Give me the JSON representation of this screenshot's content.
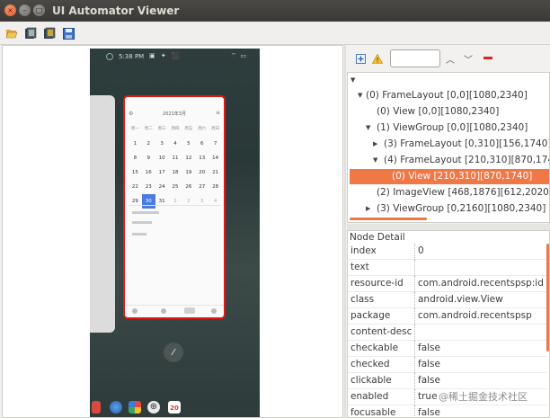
{
  "window": {
    "title": "UI Automator Viewer"
  },
  "icons": {
    "open": "folder-open-icon",
    "screenshot": "device-screenshot-icon",
    "screenshot_compressed": "device-screenshot-compressed-icon",
    "save": "save-icon",
    "expand": "expand-all-icon",
    "warning": "warning-icon",
    "prev": "chevron-up-icon",
    "next": "chevron-down-icon",
    "clear": "clear-icon"
  },
  "device": {
    "status_time": "5:38 PM",
    "calendar_month": "2021年3月",
    "weekdays": [
      "周一",
      "周二",
      "周三",
      "周四",
      "周五",
      "周六",
      "周日"
    ],
    "weeks": [
      [
        "1",
        "2",
        "3",
        "4",
        "5",
        "6",
        "7"
      ],
      [
        "8",
        "9",
        "10",
        "11",
        "12",
        "13",
        "14"
      ],
      [
        "15",
        "16",
        "17",
        "18",
        "19",
        "20",
        "21"
      ],
      [
        "22",
        "23",
        "24",
        "25",
        "26",
        "27",
        "28"
      ],
      [
        "29",
        "30",
        "31",
        "1",
        "2",
        "3",
        "4"
      ]
    ],
    "selected_day": "30",
    "dock_badge": "20"
  },
  "tree": {
    "nodes": [
      {
        "label": "(0) FrameLayout [0,0][1080,2340]",
        "arrow": "▼"
      },
      {
        "label": "(0) View [0,0][1080,2340]",
        "arrow": ""
      },
      {
        "label": "(1) ViewGroup [0,0][1080,2340]",
        "arrow": "▼"
      },
      {
        "label": "(3) FrameLayout [0,310][156,1740]",
        "arrow": "▶"
      },
      {
        "label": "(4) FrameLayout [210,310][870,174",
        "arrow": "▼"
      },
      {
        "label": "(0) View [210,310][870,1740]",
        "arrow": ""
      },
      {
        "label": "(2) ImageView [468,1876][612,2020]",
        "arrow": ""
      },
      {
        "label": "(3) ViewGroup [0,2160][1080,2340]",
        "arrow": "▶"
      }
    ]
  },
  "detail": {
    "title": "Node Detail",
    "rows": [
      {
        "key": "index",
        "value": "0"
      },
      {
        "key": "text",
        "value": ""
      },
      {
        "key": "resource-id",
        "value": "com.android.recentspsp:id"
      },
      {
        "key": "class",
        "value": "android.view.View"
      },
      {
        "key": "package",
        "value": "com.android.recentspsp"
      },
      {
        "key": "content-desc",
        "value": ""
      },
      {
        "key": "checkable",
        "value": "false"
      },
      {
        "key": "checked",
        "value": "false"
      },
      {
        "key": "clickable",
        "value": "false"
      },
      {
        "key": "enabled",
        "value": "true"
      },
      {
        "key": "focusable",
        "value": "false"
      }
    ]
  },
  "watermark": "@稀土掘金技术社区",
  "colors": {
    "selection": "#f07746",
    "highlight_border": "#e01818",
    "calendar_selected": "#4a7be0"
  }
}
